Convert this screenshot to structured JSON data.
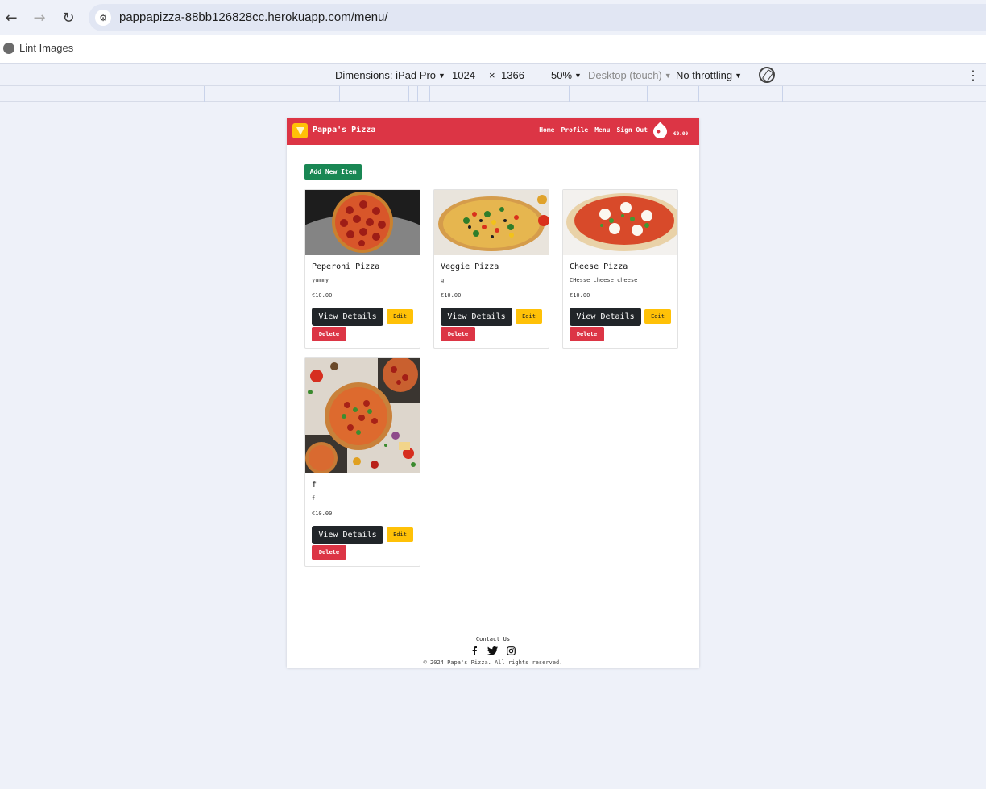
{
  "browser": {
    "url": "pappapizza-88bb126828cc.herokuapp.com/menu/",
    "bookmark": "Lint Images",
    "back_icon": "←",
    "forward_icon": "→",
    "reload_icon": "↻",
    "site_info_icon": "⚙"
  },
  "devtools": {
    "dimensions_label": "Dimensions: iPad Pro",
    "width": "1024",
    "times": "×",
    "height": "1366",
    "zoom": "50%",
    "device_type": "Desktop (touch)",
    "throttling": "No throttling",
    "caret": "▼",
    "more": "⋮"
  },
  "site": {
    "brand": "Pappa's Pizza",
    "nav": [
      "Home",
      "Profile",
      "Menu",
      "Sign Out"
    ],
    "cart_total": "€0.00",
    "add_new_item": "Add New Item",
    "view_details": "View Details",
    "edit": "Edit",
    "delete": "Delete",
    "items": [
      {
        "name": "Peperoni Pizza",
        "description": "yummy",
        "price": "€10.00"
      },
      {
        "name": "Veggie Pizza",
        "description": "g",
        "price": "€10.00"
      },
      {
        "name": "Cheese Pizza",
        "description": "CHesse cheese cheese",
        "price": "€10.00"
      },
      {
        "name": "f",
        "description": "f",
        "price": "€10.00"
      }
    ],
    "footer": {
      "contact": "Contact Us",
      "copyright": "© 2024 Papa's Pizza. All rights reserved.",
      "social_icons": [
        "facebook-icon",
        "twitter-icon",
        "instagram-icon"
      ]
    }
  },
  "colors": {
    "navbar": "#dc3545",
    "add_button": "#198754",
    "edit_button": "#ffc107",
    "delete_button": "#dc3545",
    "view_button": "#212529"
  }
}
